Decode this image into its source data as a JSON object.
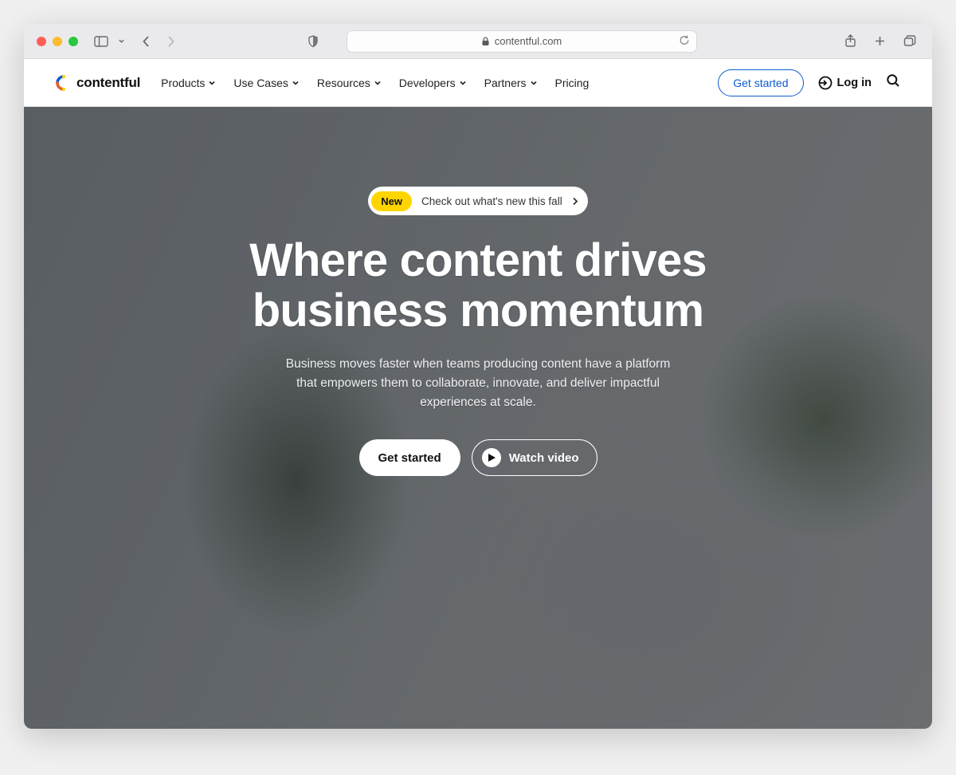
{
  "browser": {
    "url_domain": "contentful.com"
  },
  "header": {
    "logo_text": "contentful",
    "nav": [
      {
        "label": "Products",
        "has_dropdown": true
      },
      {
        "label": "Use Cases",
        "has_dropdown": true
      },
      {
        "label": "Resources",
        "has_dropdown": true
      },
      {
        "label": "Developers",
        "has_dropdown": true
      },
      {
        "label": "Partners",
        "has_dropdown": true
      },
      {
        "label": "Pricing",
        "has_dropdown": false
      }
    ],
    "get_started": "Get started",
    "log_in": "Log in"
  },
  "hero": {
    "announcement_badge": "New",
    "announcement_text": "Check out what's new this fall",
    "headline": "Where content drives business momentum",
    "subhead": "Business moves faster when teams producing content have a platform that empowers them to collaborate, innovate, and deliver impactful experiences at scale.",
    "cta_primary": "Get started",
    "cta_video": "Watch video"
  }
}
